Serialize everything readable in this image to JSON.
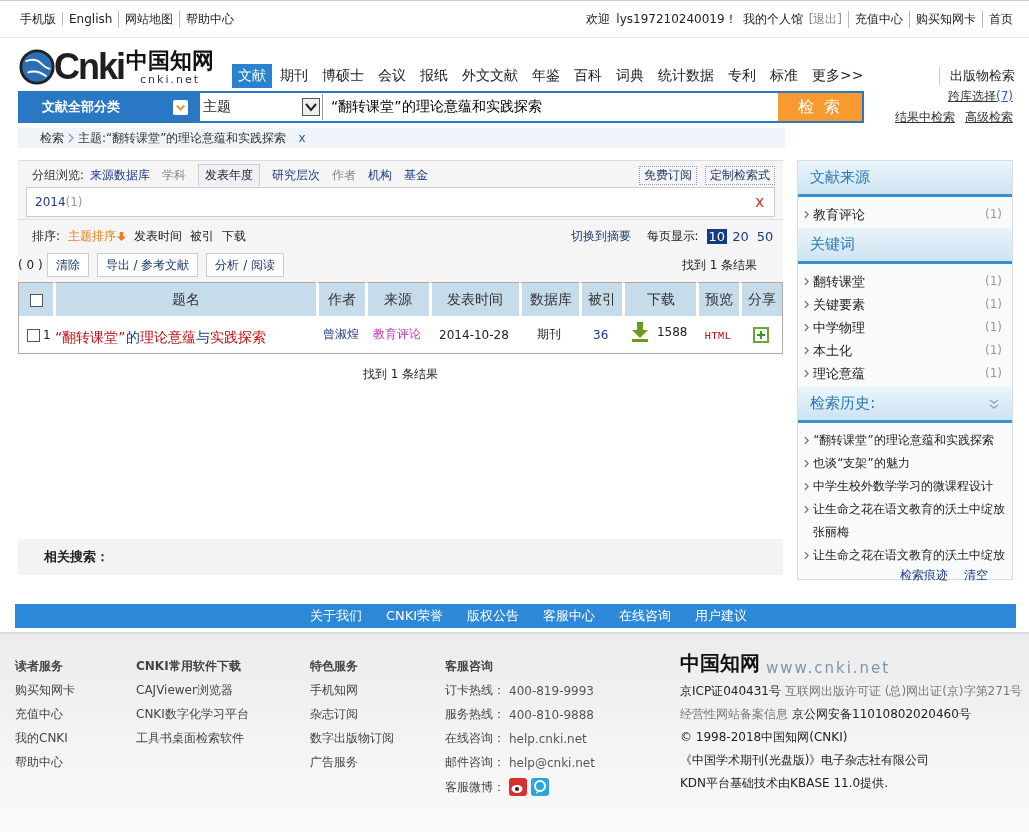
{
  "top_bar": {
    "left_links": [
      "手机版",
      "English",
      "网站地图",
      "帮助中心"
    ],
    "welcome": "欢迎",
    "username": "lys197210240019！",
    "my_library": "我的个人馆",
    "logout": "[退出]",
    "right_links": [
      "充值中心",
      "购买知网卡",
      "首页"
    ]
  },
  "logo": {
    "wordmark": "Cnki",
    "chinese": "中国知网",
    "domain": "cnki.net"
  },
  "nav_tabs": [
    {
      "label": "文献",
      "selected": true
    },
    {
      "label": "期刊",
      "selected": false
    },
    {
      "label": "博硕士",
      "selected": false
    },
    {
      "label": "会议",
      "selected": false
    },
    {
      "label": "报纸",
      "selected": false
    },
    {
      "label": "外文文献",
      "selected": false
    },
    {
      "label": "年鉴",
      "selected": false
    },
    {
      "label": "百科",
      "selected": false
    },
    {
      "label": "词典",
      "selected": false
    },
    {
      "label": "统计数据",
      "selected": false
    },
    {
      "label": "专利",
      "selected": false
    },
    {
      "label": "标准",
      "selected": false
    },
    {
      "label": "更多>>",
      "selected": false
    }
  ],
  "publication_search": "出版物检索",
  "search": {
    "category": "文献全部分类",
    "field": "主题",
    "query": "“翻转课堂”的理论意蕴和实践探索",
    "button": "检 索",
    "cross_db": "跨库选择",
    "cross_db_count": "(7)",
    "in_results": "结果中检索",
    "advanced": "高级检索"
  },
  "breadcrumb": {
    "root": "检索",
    "current": "主题:“翻转课堂”的理论意蕴和实践探索",
    "remove": "x"
  },
  "group_browse": {
    "label": "分组浏览:",
    "items": [
      {
        "label": "来源数据库",
        "selected": false,
        "disabled": false
      },
      {
        "label": "学科",
        "selected": false,
        "disabled": true
      },
      {
        "label": "发表年度",
        "selected": true,
        "disabled": false
      },
      {
        "label": "研究层次",
        "selected": false,
        "disabled": false
      },
      {
        "label": "作者",
        "selected": false,
        "disabled": true
      },
      {
        "label": "机构",
        "selected": false,
        "disabled": false
      },
      {
        "label": "基金",
        "selected": false,
        "disabled": false
      }
    ],
    "actions": [
      "免费订阅",
      "定制检索式"
    ],
    "filter": {
      "year": "2014",
      "count": "(1)",
      "clear": "x"
    }
  },
  "sort": {
    "label": "排序:",
    "items": [
      {
        "label": "主题排序",
        "selected": true
      },
      {
        "label": "发表时间",
        "selected": false
      },
      {
        "label": "被引",
        "selected": false
      },
      {
        "label": "下载",
        "selected": false
      }
    ],
    "switch": "切换到摘要",
    "per_page_label": "每页显示:",
    "per_page": [
      {
        "label": "10",
        "selected": true
      },
      {
        "label": "20",
        "selected": false
      },
      {
        "label": "50",
        "selected": false
      }
    ]
  },
  "toolbar": {
    "count": "( 0 )",
    "buttons": [
      "清除",
      "导出 / 参考文献",
      "分析 / 阅读"
    ],
    "found": "找到 1 条结果"
  },
  "table": {
    "select_all": {
      "checked": false
    },
    "columns": [
      "题名",
      "作者",
      "来源",
      "发表时间",
      "数据库",
      "被引",
      "下载",
      "预览",
      "分享"
    ],
    "rows": [
      {
        "checked": false,
        "index": "1",
        "title": [
          {
            "text": "“翻转课堂”",
            "hit": true
          },
          {
            "text": "的",
            "hit": false
          },
          {
            "text": "理论意蕴",
            "hit": true
          },
          {
            "text": "与",
            "hit": false
          },
          {
            "text": "实践探索",
            "hit": true
          }
        ],
        "author": "曾淑煌",
        "source": "教育评论",
        "date": "2014-10-28",
        "database": "期刊",
        "citations": "36",
        "downloads": "1588",
        "preview": "HTML"
      }
    ]
  },
  "found_bottom": "找到 1 条结果",
  "related": {
    "label": "相关搜索："
  },
  "sidebar": {
    "sections": [
      {
        "title": "文献来源",
        "kind": "facet",
        "items": [
          {
            "label": "教育评论",
            "count": "(1)"
          }
        ]
      },
      {
        "title": "关键词",
        "kind": "facet",
        "items": [
          {
            "label": "翻转课堂",
            "count": "(1)"
          },
          {
            "label": "关键要素",
            "count": "(1)"
          },
          {
            "label": "中学物理",
            "count": "(1)"
          },
          {
            "label": "本土化",
            "count": "(1)"
          },
          {
            "label": "理论意蕴",
            "count": "(1)"
          }
        ]
      },
      {
        "title": "检索历史:",
        "kind": "history",
        "items": [
          {
            "label": "“翻转课堂”的理论意蕴和实践探索"
          },
          {
            "label": "也谈“支架”的魅力"
          },
          {
            "label": "中学生校外数学学习的微课程设计"
          },
          {
            "label": "让生命之花在语文教育的沃土中绽放张丽梅"
          },
          {
            "label": "让生命之花在语文教育的沃土中绽放"
          }
        ],
        "links": [
          "检索痕迹",
          "清空"
        ]
      }
    ]
  },
  "footer_bar": [
    "关于我们",
    "CNKI荣誉",
    "版权公告",
    "客服中心",
    "在线咨询",
    "用户建议"
  ],
  "footer": {
    "columns": [
      {
        "heading": "读者服务",
        "items": [
          "购买知网卡",
          "充值中心",
          "我的CNKI",
          "帮助中心"
        ]
      },
      {
        "heading": "CNKI常用软件下载",
        "items": [
          "CAJViewer浏览器",
          "CNKI数字化学习平台",
          "工具书桌面检索软件"
        ]
      },
      {
        "heading": "特色服务",
        "items": [
          "手机知网",
          "杂志订阅",
          "数字出版物订阅",
          "广告服务"
        ]
      }
    ],
    "contact": {
      "heading": "客服咨询",
      "rows": [
        {
          "label": "订卡热线：",
          "value": "400-819-9993"
        },
        {
          "label": "服务热线：",
          "value": "400-810-9888"
        },
        {
          "label": "在线咨询：",
          "value": "help.cnki.net"
        },
        {
          "label": "邮件咨询：",
          "value": "help@cnki.net"
        }
      ],
      "weibo": "客服微博："
    },
    "brand": {
      "chinese": "中国知网",
      "url": "www.cnki.net"
    },
    "lines": [
      [
        {
          "text": "京ICP证040431号",
          "dark": true
        },
        {
          "text": "互联网出版许可证 (总)网出证(京)字第271号",
          "dark": false
        }
      ],
      [
        {
          "text": "经营性网站备案信息",
          "dark": false
        },
        {
          "text": "京公网安备11010802020460号",
          "dark": true
        }
      ],
      [
        {
          "text": "© 1998-2018中国知网(CNKI)",
          "dark": true
        }
      ],
      [
        {
          "text": "《中国学术期刊(光盘版)》电子杂志社有限公司",
          "dark": true
        }
      ],
      [
        {
          "text": "KDN平台基础技术由KBASE 11.0提供.",
          "dark": true
        }
      ]
    ]
  }
}
